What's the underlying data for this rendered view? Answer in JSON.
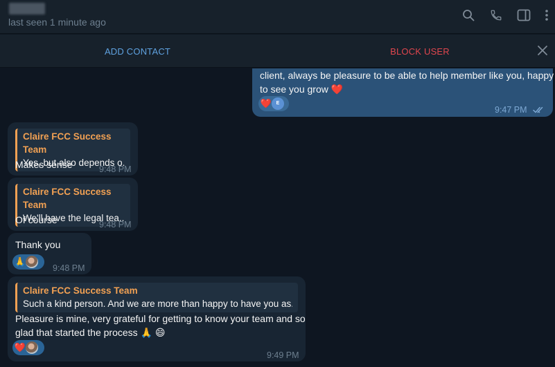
{
  "header": {
    "last_seen": "last seen 1 minute ago",
    "icons": [
      "search-icon",
      "phone-icon",
      "sidebar-toggle-icon",
      "more-vertical-icon"
    ]
  },
  "action_bar": {
    "add_contact": "ADD CONTACT",
    "block_user": "BLOCK USER"
  },
  "messages": [
    {
      "direction": "outgoing",
      "text": "client, always be pleasure to be able to help member like you, happy to see you grow ❤️",
      "line1": "client, always be pleasure to be able to help member like you, happy",
      "line2": "to see you grow",
      "line2_emoji": "❤️",
      "reaction": "❤️",
      "reactor_initial": "E",
      "time": "9:47 PM",
      "status": "read"
    },
    {
      "direction": "incoming",
      "reply_name": "Claire FCC Success Team",
      "reply_text": "Yes, but also depends o...",
      "text": "Makes sense",
      "time": "9:48 PM"
    },
    {
      "direction": "incoming",
      "reply_name": "Claire FCC Success Team",
      "reply_text": "We'll have the legal tea...",
      "text": "Of course",
      "time": "9:48 PM"
    },
    {
      "direction": "incoming",
      "text": "Thank you",
      "reaction": "🙏",
      "time": "9:48 PM"
    },
    {
      "direction": "incoming",
      "reply_name": "Claire FCC Success Team",
      "reply_text": "Such a kind person. And we are more than happy to have you as...",
      "line1": "Pleasure is mine, very grateful for getting to know your team and so",
      "line2": "glad that started the process",
      "line2_emoji": "🙏 😄",
      "reaction": "❤️",
      "time": "9:49 PM"
    }
  ],
  "colors": {
    "background": "#0e1621",
    "header": "#17212b",
    "outgoing_bubble": "#2b5278",
    "incoming_bubble": "#182533",
    "reply_accent": "#f2a153",
    "add_contact": "#5fa2e0",
    "block_user": "#e0464e"
  }
}
